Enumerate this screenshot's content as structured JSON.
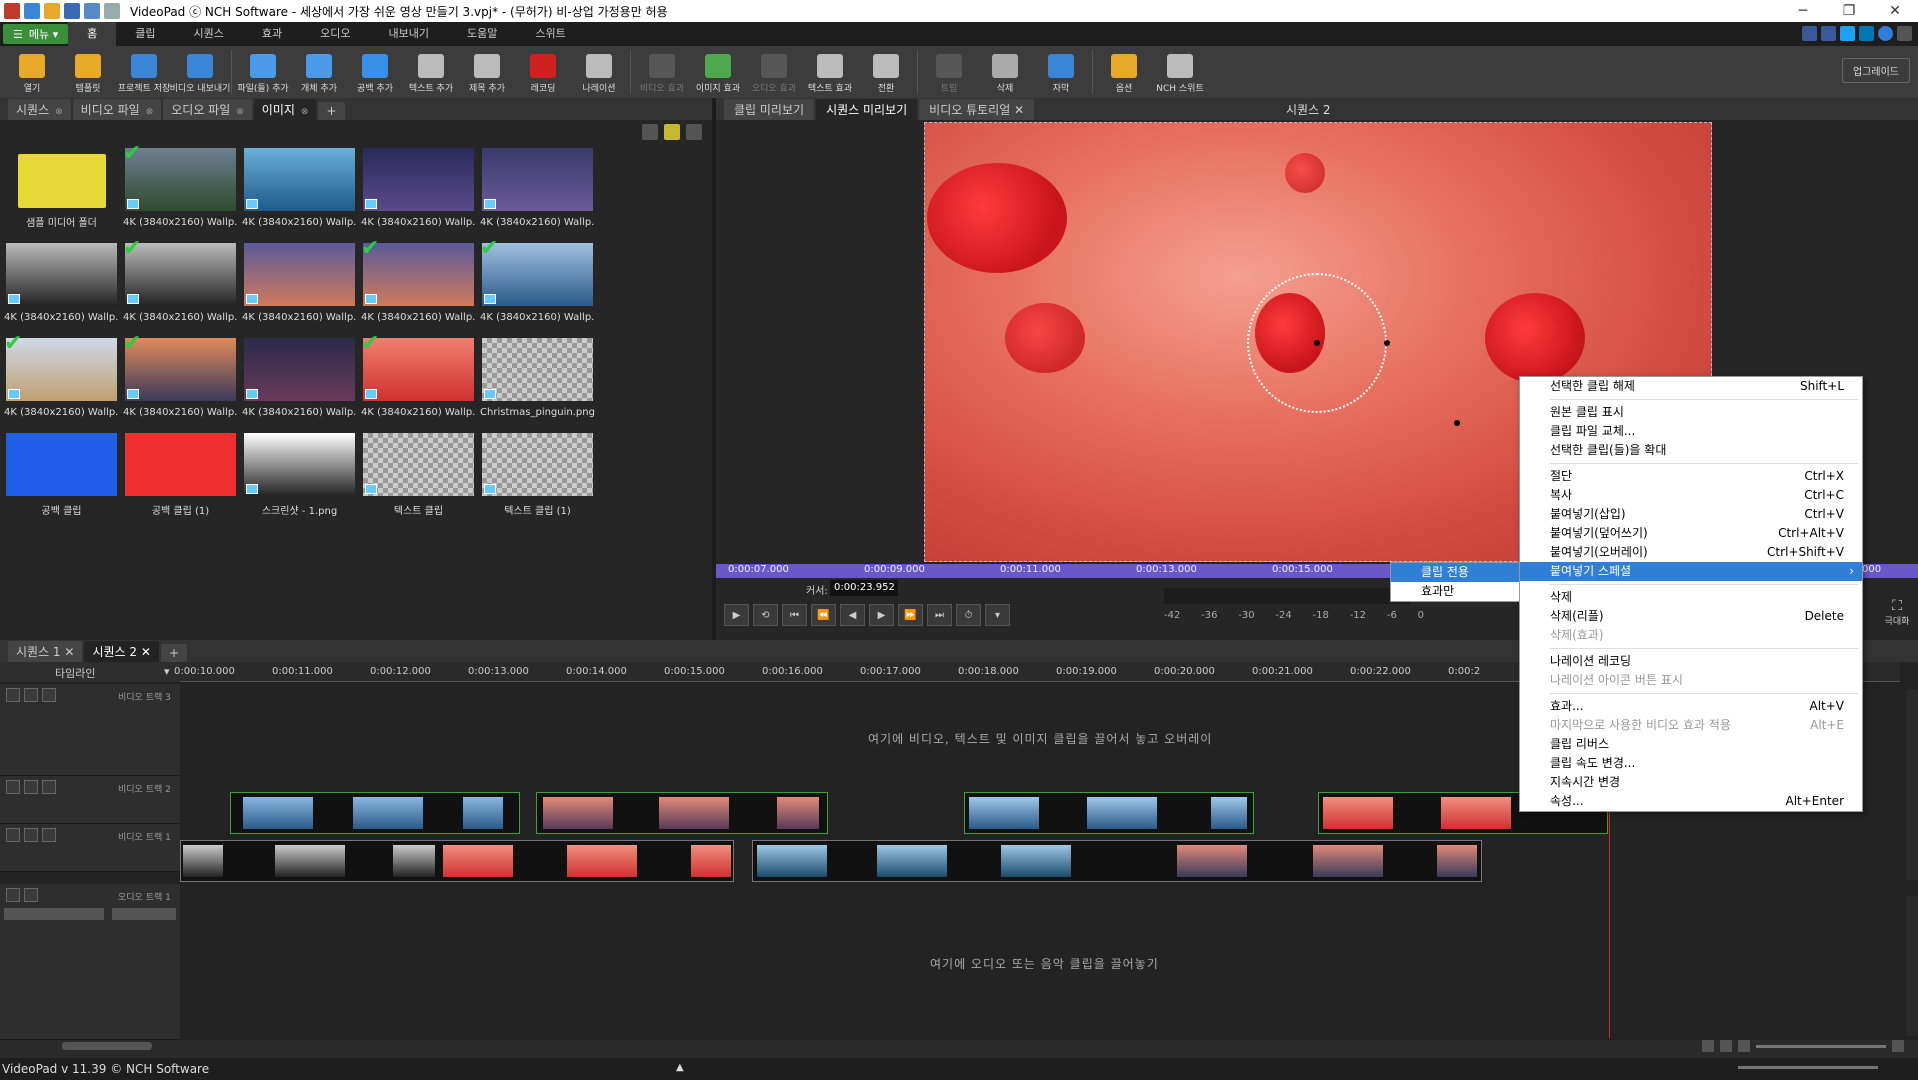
{
  "window": {
    "title": "VideoPad ⓒ NCH Software - 세상에서 가장 쉬운 영상 만들기 3.vpj* - (무허가) 비-상업 가정용만 허용",
    "minimize": "─",
    "restore": "❐",
    "close": "✕"
  },
  "menubar": {
    "menu_button": "메뉴 ▾",
    "tabs": [
      "홈",
      "클립",
      "시퀀스",
      "효과",
      "오디오",
      "내보내기",
      "도움말",
      "스위트"
    ]
  },
  "toolbar": {
    "buttons": [
      {
        "label": "열기",
        "color": "#e8a92a"
      },
      {
        "label": "템플릿",
        "color": "#e8a92a"
      },
      {
        "label": "프로젝트 저장",
        "color": "#3a86d6"
      },
      {
        "label": "비디오 내보내기",
        "color": "#3a86d6"
      },
      {
        "label": "파일(들) 추가",
        "color": "#4a9ae8"
      },
      {
        "label": "개체 추가",
        "color": "#4a9ae8"
      },
      {
        "label": "공백 추가",
        "color": "#3a8fe8"
      },
      {
        "label": "텍스트 추가",
        "color": "#bbbbbb"
      },
      {
        "label": "제목 추가",
        "color": "#bbbbbb"
      },
      {
        "label": "레코딩",
        "color": "#d02020"
      },
      {
        "label": "나레이션",
        "color": "#bbbbbb"
      },
      {
        "label": "비디오 효과",
        "color": "#888888",
        "disabled": true
      },
      {
        "label": "이미지 효과",
        "color": "#4caa4c"
      },
      {
        "label": "오디오 효과",
        "color": "#888888",
        "disabled": true
      },
      {
        "label": "텍스트 효과",
        "color": "#bbbbbb"
      },
      {
        "label": "전환",
        "color": "#bbbbbb"
      },
      {
        "label": "트림",
        "color": "#888888",
        "disabled": true
      },
      {
        "label": "삭제",
        "color": "#aaaaaa"
      },
      {
        "label": "자막",
        "color": "#3a86d6"
      },
      {
        "label": "옵션",
        "color": "#e8a92a"
      },
      {
        "label": "NCH 스위트",
        "color": "#bbbbbb"
      }
    ],
    "upgrade": "업그레이드"
  },
  "media_panel": {
    "tabs": [
      {
        "label": "시퀀스",
        "close": "⊗"
      },
      {
        "label": "비디오 파일",
        "close": "⊗"
      },
      {
        "label": "오디오 파일",
        "close": "⊗"
      },
      {
        "label": "이미지",
        "close": "⊗"
      }
    ],
    "add_tab": "+",
    "items": [
      {
        "caption": "샘플 미디어 폴더",
        "kind": "folder"
      },
      {
        "caption": "4K (3840x2160) Wallp...",
        "kind": "img",
        "check": true,
        "c1": "#6e7f90",
        "c2": "#2f4a2f"
      },
      {
        "caption": "4K (3840x2160) Wallp...",
        "kind": "img",
        "check": false,
        "c1": "#6ab0d8",
        "c2": "#1e5a8a"
      },
      {
        "caption": "4K (3840x2160) Wallp...",
        "kind": "img",
        "check": false,
        "c1": "#2a2a5a",
        "c2": "#5a4a8a"
      },
      {
        "caption": "4K (3840x2160) Wallp...",
        "kind": "img",
        "check": false,
        "c1": "#3a3a6a",
        "c2": "#6a5a9a"
      },
      {
        "caption": "4K (3840x2160) Wallp...",
        "kind": "img",
        "check": false,
        "c1": "#bbbbbb",
        "c2": "#222222"
      },
      {
        "caption": "4K (3840x2160) Wallp...",
        "kind": "img",
        "check": true,
        "c1": "#bbbbbb",
        "c2": "#222222"
      },
      {
        "caption": "4K (3840x2160) Wallp...",
        "kind": "img",
        "check": false,
        "c1": "#5a5a9a",
        "c2": "#d07a5a"
      },
      {
        "caption": "4K (3840x2160) Wallp...",
        "kind": "img",
        "check": true,
        "c1": "#5a5a9a",
        "c2": "#d07a5a"
      },
      {
        "caption": "4K (3840x2160) Wallp...",
        "kind": "img",
        "check": true,
        "c1": "#a0c0e0",
        "c2": "#2a5a8a"
      },
      {
        "caption": "4K (3840x2160) Wallp...",
        "kind": "img",
        "check": true,
        "c1": "#d0d8e8",
        "c2": "#c0a070"
      },
      {
        "caption": "4K (3840x2160) Wallp...",
        "kind": "img",
        "check": true,
        "c1": "#e08a5a",
        "c2": "#3a3a5a"
      },
      {
        "caption": "4K (3840x2160) Wallp...",
        "kind": "img",
        "check": false,
        "c1": "#2a2a4a",
        "c2": "#6a3a5a"
      },
      {
        "caption": "4K (3840x2160) Wallp...",
        "kind": "img",
        "check": true,
        "c1": "#f08070",
        "c2": "#d03030"
      },
      {
        "caption": "Christmas_pinguin.png",
        "kind": "checker",
        "check": false
      },
      {
        "caption": "공백 클립",
        "kind": "solid",
        "check": false,
        "c1": "#2060e8",
        "c2": "#2060e8"
      },
      {
        "caption": "공백 클립 (1)",
        "kind": "solid",
        "check": false,
        "c1": "#f03030",
        "c2": "#f03030"
      },
      {
        "caption": "스크린샷 - 1.png",
        "kind": "img",
        "check": false,
        "c1": "#ffffff",
        "c2": "#222222"
      },
      {
        "caption": "텍스트 클립",
        "kind": "checker",
        "check": false
      },
      {
        "caption": "텍스트 클립 (1)",
        "kind": "checker",
        "check": false
      }
    ]
  },
  "preview": {
    "tabs": [
      {
        "label": "클립 미리보기",
        "close": ""
      },
      {
        "label": "시퀀스 미리보기",
        "close": ""
      },
      {
        "label": "비디오 튜토리얼",
        "close": "✕"
      }
    ],
    "sequence_label": "시퀀스 2",
    "ruler_times": [
      "0:00:07.000",
      "0:00:09.000",
      "0:00:11.000",
      "0:00:13.000",
      "0:00:15.000",
      "000"
    ],
    "cursor_label": "커서:",
    "cursor_value": "0:00:23.952",
    "meter_labels": [
      "-42",
      "-36",
      "-30",
      "-24",
      "-18",
      "-12",
      "-6",
      "0"
    ],
    "fullscreen_label": "극대화",
    "transport": [
      "▶",
      "⟲",
      "⏮",
      "⏪",
      "◀",
      "▶",
      "⏩",
      "⏭",
      "⏱",
      "▾"
    ]
  },
  "timeline": {
    "sequence_tabs": [
      {
        "label": "시퀀스 1",
        "close": "✕"
      },
      {
        "label": "시퀀스 2",
        "close": "✕"
      }
    ],
    "add_tab": "+",
    "header_label": "타임라인",
    "header_arrow": "▾",
    "ruler": [
      "0:00:10.000",
      "0:00:11.000",
      "0:00:12.000",
      "0:00:13.000",
      "0:00:14.000",
      "0:00:15.000",
      "0:00:16.000",
      "0:00:17.000",
      "0:00:18.000",
      "0:00:19.000",
      "0:00:20.000",
      "0:00:21.000",
      "0:00:22.000",
      "0:00:2"
    ],
    "tracks": {
      "video3": "비디오 트랙 3",
      "video2": "비디오 트랙 2",
      "video1": "비디오 트랙 1",
      "audio1": "오디오 트랙 1"
    },
    "video_hint": "여기에 비디오, 텍스트 및 이미지 클립을 끌어서 놓고 오버레이",
    "audio_hint": "여기에 오디오 또는 음악 클립을 끌어놓기"
  },
  "context_menu": {
    "groups": [
      [
        {
          "label": "선택한 클립 해제",
          "shortcut": "Shift+L"
        }
      ],
      [
        {
          "label": "원본 클립 표시",
          "shortcut": ""
        },
        {
          "label": "클립 파일 교체...",
          "shortcut": ""
        },
        {
          "label": "선택한 클립(들)을 확대",
          "shortcut": ""
        }
      ],
      [
        {
          "label": "절단",
          "shortcut": "Ctrl+X"
        },
        {
          "label": "복사",
          "shortcut": "Ctrl+C"
        },
        {
          "label": "붙여넣기(삽입)",
          "shortcut": "Ctrl+V"
        },
        {
          "label": "붙여넣기(덮어쓰기)",
          "shortcut": "Ctrl+Alt+V"
        },
        {
          "label": "붙여넣기(오버레이)",
          "shortcut": "Ctrl+Shift+V"
        },
        {
          "label": "붙여넣기 스페셜",
          "shortcut": "",
          "highlight": true,
          "submenu": "›"
        }
      ],
      [
        {
          "label": "삭제",
          "shortcut": ""
        },
        {
          "label": "삭제(리플)",
          "shortcut": "Delete"
        },
        {
          "label": "삭제(효과)",
          "shortcut": "",
          "disabled": true
        }
      ],
      [
        {
          "label": "나레이션 레코딩",
          "shortcut": ""
        },
        {
          "label": "나레이션 아이콘 버튼 표시",
          "shortcut": "",
          "disabled": true
        }
      ],
      [
        {
          "label": "효과...",
          "shortcut": "Alt+V"
        },
        {
          "label": "마지막으로 사용한 비디오 효과 적용",
          "shortcut": "Alt+E",
          "disabled": true
        },
        {
          "label": "클립 리버스",
          "shortcut": ""
        },
        {
          "label": "클립 속도 변경...",
          "shortcut": ""
        },
        {
          "label": "지속시간 변경",
          "shortcut": ""
        },
        {
          "label": "속성...",
          "shortcut": "Alt+Enter"
        }
      ]
    ],
    "submenu": [
      "클립 전용",
      "효과만"
    ]
  },
  "status": {
    "text": "VideoPad v 11.39 © NCH Software",
    "marker": "▲"
  }
}
